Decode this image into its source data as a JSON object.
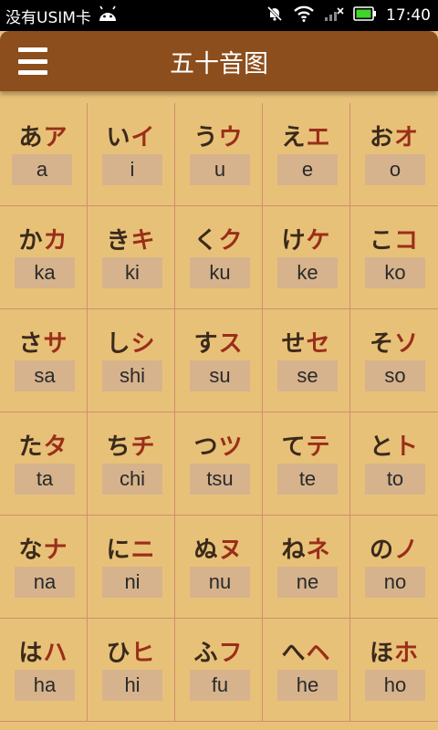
{
  "status_bar": {
    "carrier": "没有USIM卡",
    "time": "17:40",
    "icons": [
      "android-icon",
      "mute-icon",
      "wifi-icon",
      "no-signal-icon",
      "battery-icon"
    ]
  },
  "app_bar": {
    "title": "五十音图",
    "menu_icon": "hamburger-menu-icon"
  },
  "colors": {
    "app_bar": "#8b4e1c",
    "background": "#e8c178",
    "hiragana": "#3a2a1c",
    "katakana": "#9a2e1a",
    "romaji_box": "#d6b38d"
  },
  "kana": [
    {
      "hira": "あ",
      "kata": "ア",
      "romaji": "a"
    },
    {
      "hira": "い",
      "kata": "イ",
      "romaji": "i"
    },
    {
      "hira": "う",
      "kata": "ウ",
      "romaji": "u"
    },
    {
      "hira": "え",
      "kata": "エ",
      "romaji": "e"
    },
    {
      "hira": "お",
      "kata": "オ",
      "romaji": "o"
    },
    {
      "hira": "か",
      "kata": "カ",
      "romaji": "ka"
    },
    {
      "hira": "き",
      "kata": "キ",
      "romaji": "ki"
    },
    {
      "hira": "く",
      "kata": "ク",
      "romaji": "ku"
    },
    {
      "hira": "け",
      "kata": "ケ",
      "romaji": "ke"
    },
    {
      "hira": "こ",
      "kata": "コ",
      "romaji": "ko"
    },
    {
      "hira": "さ",
      "kata": "サ",
      "romaji": "sa"
    },
    {
      "hira": "し",
      "kata": "シ",
      "romaji": "shi"
    },
    {
      "hira": "す",
      "kata": "ス",
      "romaji": "su"
    },
    {
      "hira": "せ",
      "kata": "セ",
      "romaji": "se"
    },
    {
      "hira": "そ",
      "kata": "ソ",
      "romaji": "so"
    },
    {
      "hira": "た",
      "kata": "タ",
      "romaji": "ta"
    },
    {
      "hira": "ち",
      "kata": "チ",
      "romaji": "chi"
    },
    {
      "hira": "つ",
      "kata": "ツ",
      "romaji": "tsu"
    },
    {
      "hira": "て",
      "kata": "テ",
      "romaji": "te"
    },
    {
      "hira": "と",
      "kata": "ト",
      "romaji": "to"
    },
    {
      "hira": "な",
      "kata": "ナ",
      "romaji": "na"
    },
    {
      "hira": "に",
      "kata": "ニ",
      "romaji": "ni"
    },
    {
      "hira": "ぬ",
      "kata": "ヌ",
      "romaji": "nu"
    },
    {
      "hira": "ね",
      "kata": "ネ",
      "romaji": "ne"
    },
    {
      "hira": "の",
      "kata": "ノ",
      "romaji": "no"
    },
    {
      "hira": "は",
      "kata": "ハ",
      "romaji": "ha"
    },
    {
      "hira": "ひ",
      "kata": "ヒ",
      "romaji": "hi"
    },
    {
      "hira": "ふ",
      "kata": "フ",
      "romaji": "fu"
    },
    {
      "hira": "へ",
      "kata": "ヘ",
      "romaji": "he"
    },
    {
      "hira": "ほ",
      "kata": "ホ",
      "romaji": "ho"
    }
  ]
}
